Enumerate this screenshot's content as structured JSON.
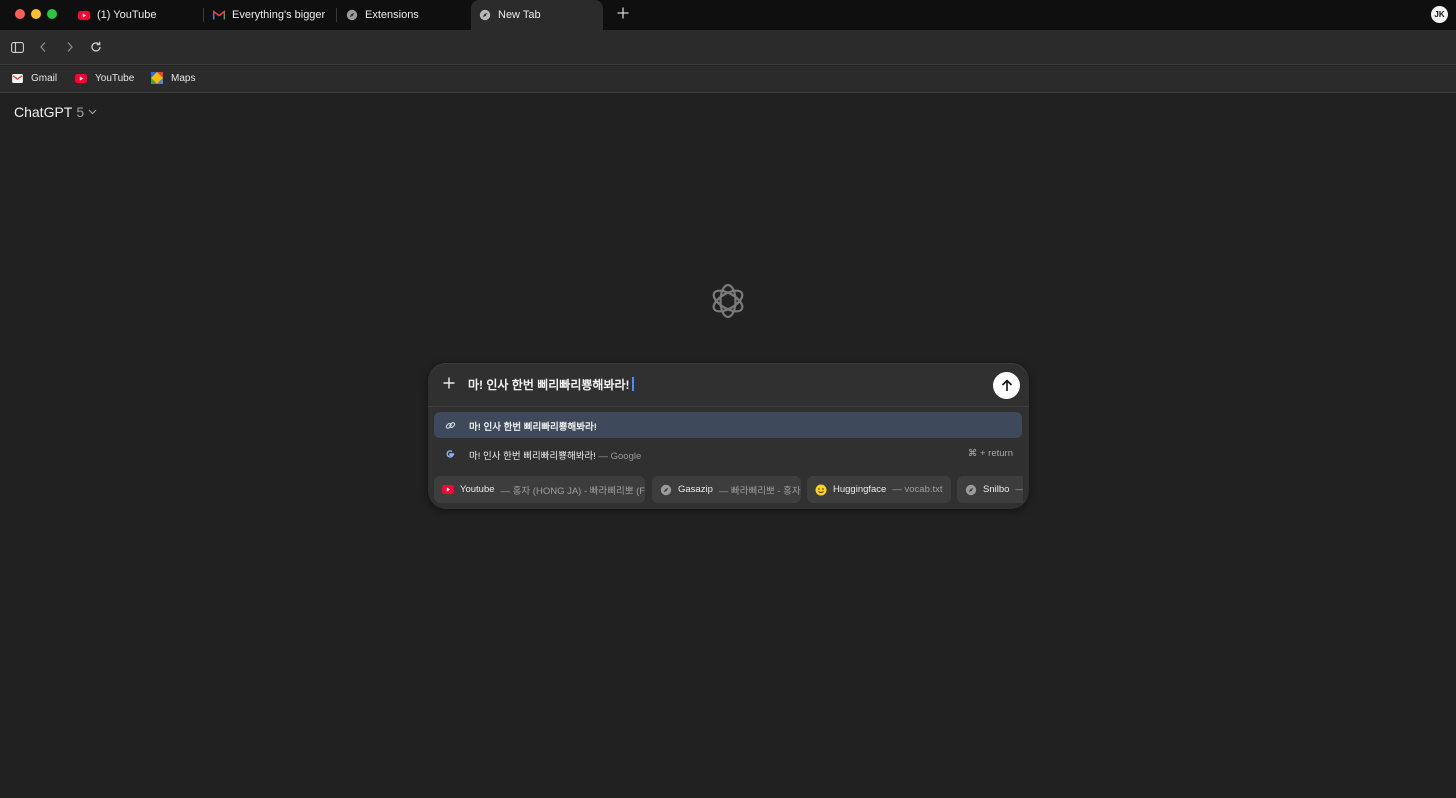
{
  "tabs": [
    {
      "label": "(1) YouTube",
      "icon": "youtube-icon"
    },
    {
      "label": "Everything's bigger in",
      "icon": "gmail-icon"
    },
    {
      "label": "Extensions",
      "icon": "compass-icon"
    },
    {
      "label": "New Tab",
      "icon": "compass-icon",
      "active": true
    }
  ],
  "profile": {
    "initials": "JK"
  },
  "bookmarks": [
    {
      "label": "Gmail",
      "icon": "gmail-icon"
    },
    {
      "label": "YouTube",
      "icon": "youtube-icon"
    },
    {
      "label": "Maps",
      "icon": "maps-icon"
    }
  ],
  "page": {
    "model_name": "ChatGPT",
    "model_version": "5"
  },
  "composer": {
    "query": "마! 인사 한번 삐리빠리뿅해봐라!",
    "suggestions": [
      {
        "text": "마! 인사 한번 삐리빠리뿅해봐라!",
        "icon": "link-icon",
        "highlighted": true
      },
      {
        "text": "마! 인사 한번 삐리빠리뿅해봐라!",
        "engine": "— Google",
        "icon": "google-icon",
        "shortcut": "⌘ + return"
      }
    ],
    "chips": [
      {
        "title": "Youtube",
        "sub": "— 홍자 (HONG JA) - 빠라삐리뽀 (F",
        "icon": "youtube-icon"
      },
      {
        "title": "Gasazip",
        "sub": "— 빠라삐리뽀 - 홍자",
        "icon": "compass-icon"
      },
      {
        "title": "Huggingface",
        "sub": "— vocab.txt",
        "icon": "huggingface-icon"
      },
      {
        "title": "Snilbo",
        "sub": "—",
        "icon": "compass-icon"
      }
    ]
  },
  "colors": {
    "page_bg": "#212121",
    "composer_bg": "#303030",
    "highlight": "#3e4a5c",
    "caret": "#4a8cff"
  }
}
